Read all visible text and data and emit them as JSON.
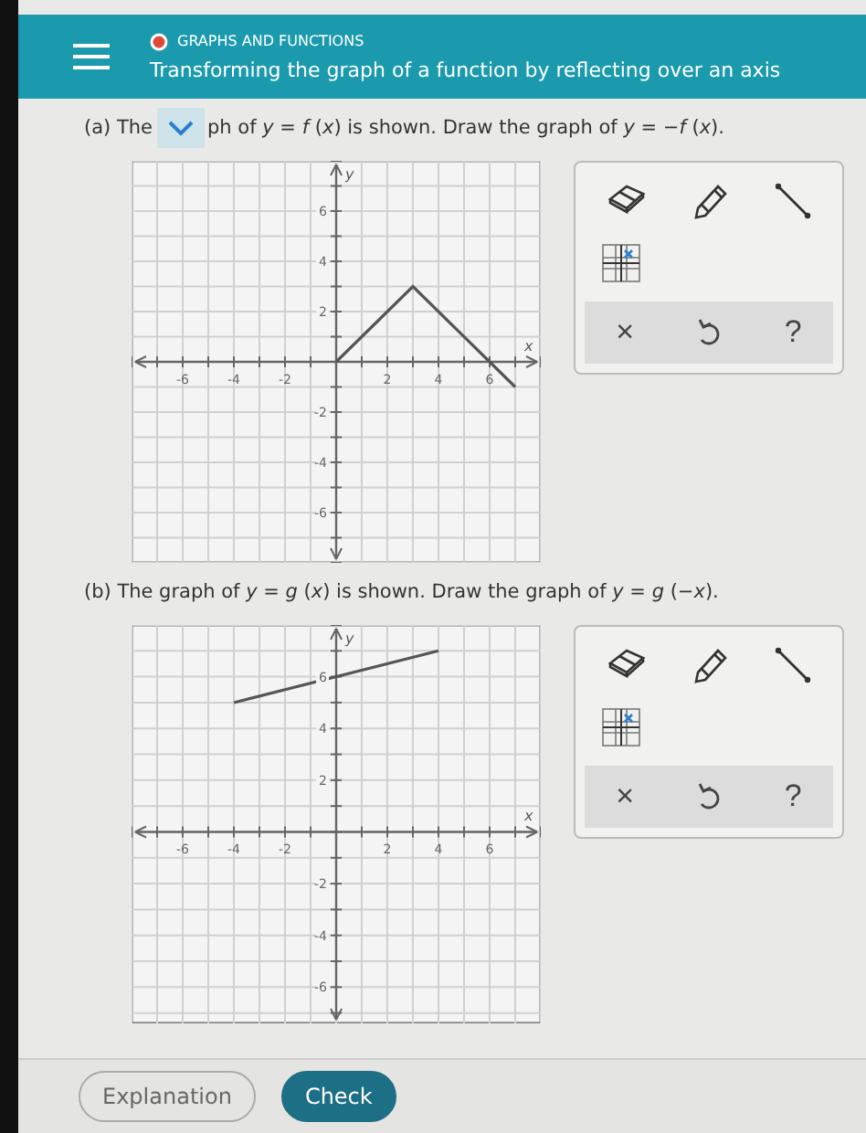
{
  "header": {
    "category": "GRAPHS AND FUNCTIONS",
    "title": "Transforming the graph of a function by reflecting over an axis"
  },
  "parts": [
    {
      "prompt_before": "(a) The",
      "prompt_after": "ph of *y* = *f* (*x*) is shown. Draw the graph of *y* = −*f* (*x*).",
      "collapse_tab": true,
      "chart_data": {
        "type": "line",
        "grid": true,
        "x": [
          0,
          3,
          7
        ],
        "series": [
          {
            "color": "#555555",
            "values": [
              0,
              3,
              -1
            ]
          }
        ],
        "xlim": [
          -8,
          8
        ],
        "ylim": [
          -8,
          8
        ],
        "xticks": [
          -6,
          -4,
          -2,
          2,
          4,
          6
        ],
        "yticks": [
          -6,
          -4,
          -2,
          2,
          4,
          6
        ],
        "xlabel": "x",
        "ylabel": "y"
      },
      "tools": {
        "clear": "×",
        "help": "?"
      }
    },
    {
      "prompt_before": "(b) The graph of *y* = *g* (*x*) is shown. Draw the graph of *y* = *g* (−*x*).",
      "chart_data": {
        "type": "line",
        "grid": true,
        "x": [
          -4,
          4
        ],
        "series": [
          {
            "color": "#555555",
            "values": [
              5,
              7
            ]
          }
        ],
        "xlim": [
          -8,
          8
        ],
        "ylim": [
          -7.4,
          8
        ],
        "xticks": [
          -6,
          -4,
          -2,
          2,
          4,
          6
        ],
        "yticks": [
          -6,
          -4,
          -2,
          2,
          4,
          6
        ],
        "xlabel": "x",
        "ylabel": "y"
      },
      "tools": {
        "clear": "×",
        "help": "?"
      }
    }
  ],
  "buttons": {
    "explanation": "Explanation",
    "check": "Check"
  }
}
